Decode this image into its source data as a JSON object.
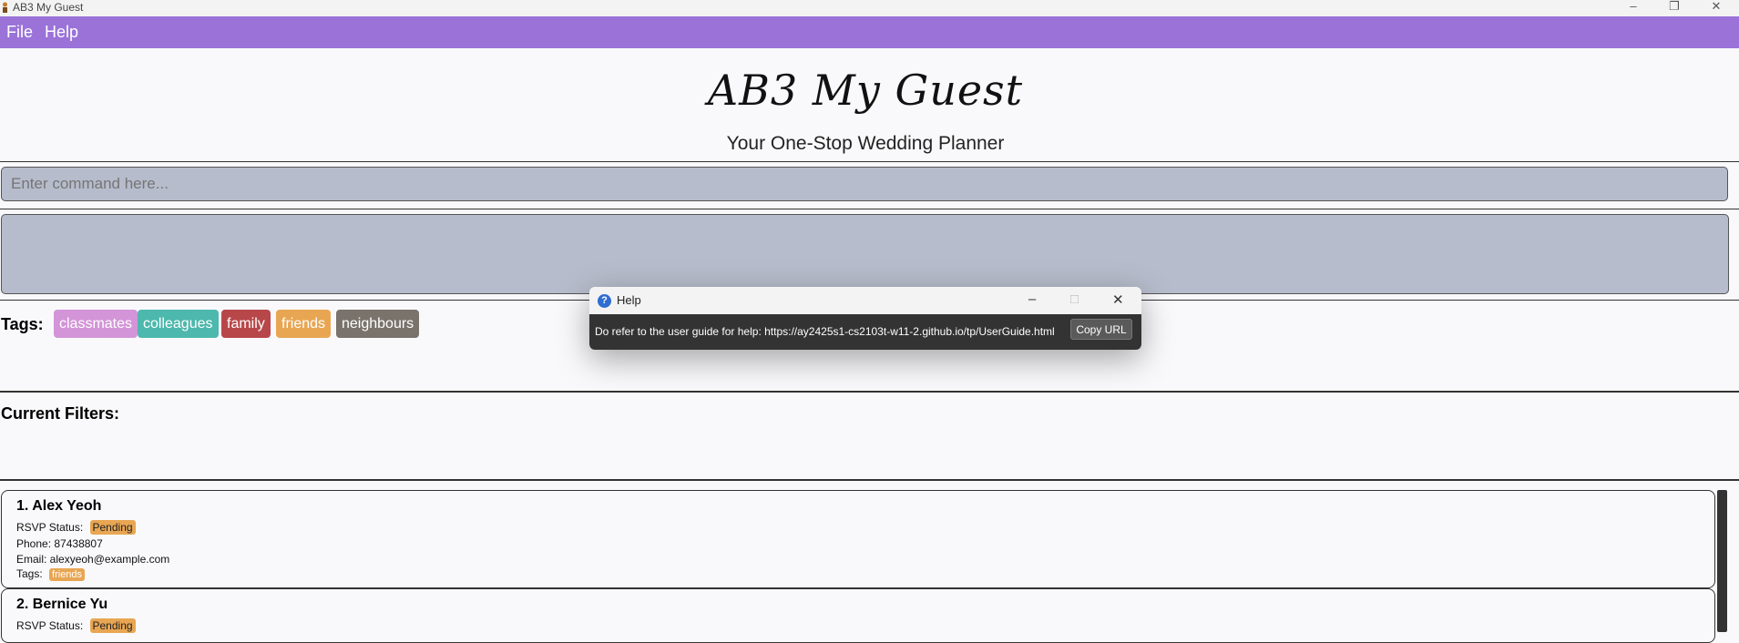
{
  "window": {
    "title": "AB3 My Guest"
  },
  "menu": {
    "file": "File",
    "help": "Help"
  },
  "header": {
    "title": "AB3 My Guest",
    "subtitle": "Your One-Stop Wedding Planner"
  },
  "command": {
    "placeholder": "Enter command here...",
    "value": ""
  },
  "tags": {
    "label": "Tags:",
    "items": [
      {
        "label": "classmates",
        "color": "#d394d8"
      },
      {
        "label": "colleagues",
        "color": "#4db8ad"
      },
      {
        "label": "family",
        "color": "#b8474a"
      },
      {
        "label": "friends",
        "color": "#e8a653"
      },
      {
        "label": "neighbours",
        "color": "#7a736c"
      }
    ]
  },
  "filters": {
    "label": "Current Filters:"
  },
  "persons": [
    {
      "name": "1. Alex Yeoh",
      "rsvp_label": "RSVP Status:",
      "rsvp": "Pending",
      "phone": "Phone: 87438807",
      "email": "Email: alexyeoh@example.com",
      "tags_label": "Tags:",
      "tag": "friends"
    },
    {
      "name": "2. Bernice Yu",
      "rsvp_label": "RSVP Status:",
      "rsvp": "Pending"
    }
  ],
  "help_dialog": {
    "title": "Help",
    "message": "Do refer to the user guide for help: https://ay2425s1-cs2103t-w11-2.github.io/tp/UserGuide.html",
    "copy_button": "Copy URL"
  },
  "colors": {
    "menu_bar": "#9a72d8",
    "box_bg": "#b6bccb",
    "pending": "#e8a653"
  }
}
